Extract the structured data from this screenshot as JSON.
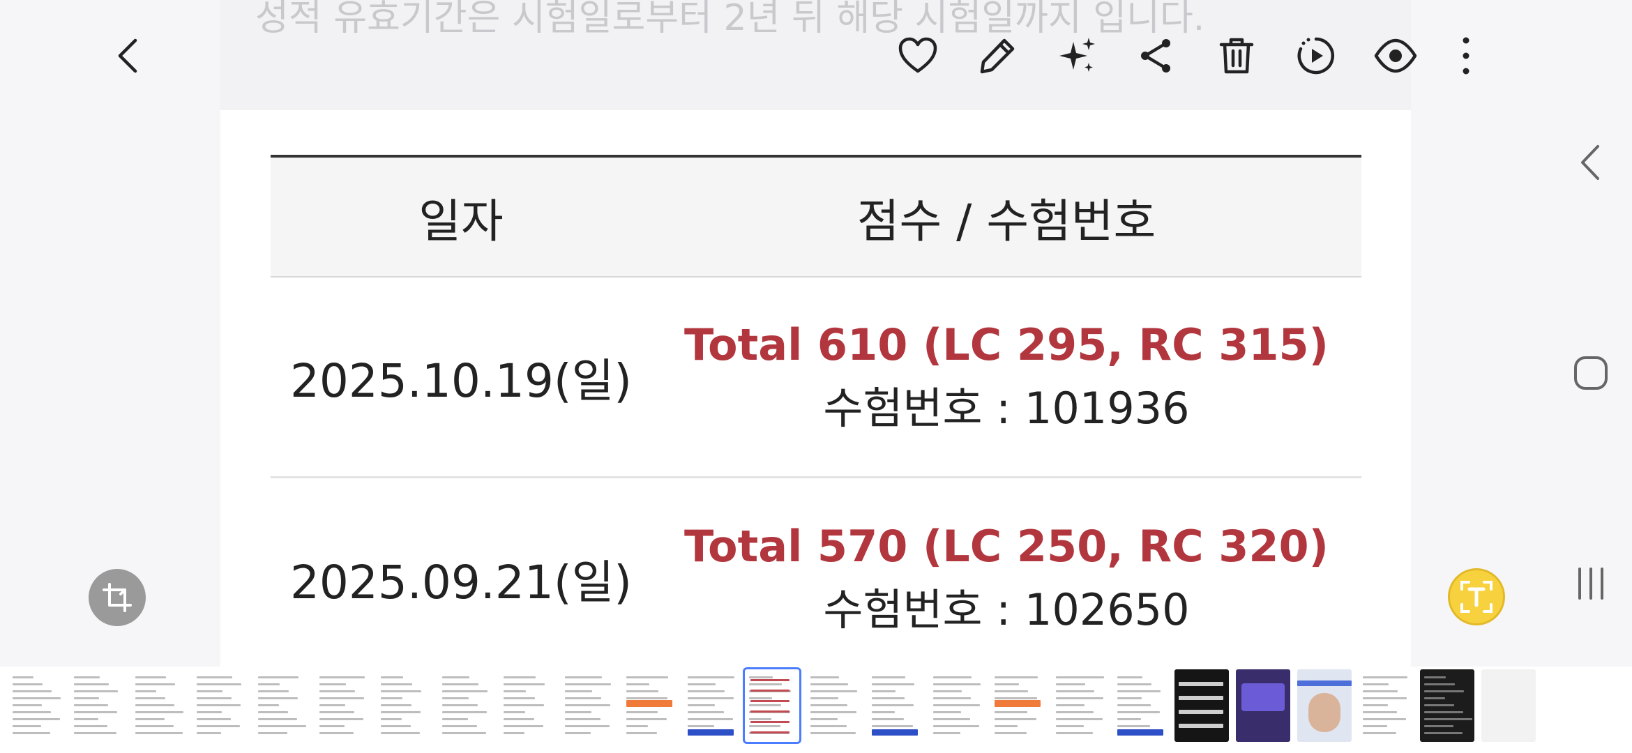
{
  "photo": {
    "faded_text": "성적 유효기간은 시험일로부터 2년 뒤 해당 시험일까지 입니다.",
    "table": {
      "headers": {
        "date": "일자",
        "score": "점수 / 수험번호"
      },
      "rows": [
        {
          "date": "2025.10.19(일)",
          "total": "Total 610 (LC 295, RC 315)",
          "regno": "수험번호 : 101936"
        },
        {
          "date": "2025.09.21(일)",
          "total": "Total 570 (LC 250, RC 320)",
          "regno": "수험번호 : 102650"
        }
      ]
    }
  },
  "toolbar": {
    "icons": [
      "back-icon",
      "heart-icon",
      "pencil-icon",
      "sparkles-icon",
      "share-icon",
      "trash-icon",
      "motion-photo-icon",
      "eye-icon",
      "more-vertical-icon"
    ]
  },
  "floating": {
    "left": "crop-icon",
    "right": "text-extract-icon"
  },
  "navigation": {
    "icons": [
      "nav-back-icon",
      "nav-home-icon",
      "nav-recents-icon"
    ]
  },
  "colors": {
    "accent_red": "#b2363d",
    "text_extract_yellow": "#f7d23e",
    "crop_gray": "#9a9a9a",
    "selected_outline": "#4a7dff"
  },
  "filmstrip": {
    "thumbnail_count": 25,
    "thumbnail_kinds": [
      "doc",
      "doc",
      "doc",
      "doc",
      "doc",
      "doc",
      "doc",
      "doc",
      "doc",
      "doc",
      "doc-orange",
      "doc-blue",
      "doc-red",
      "doc",
      "doc-blue",
      "doc",
      "doc-orange",
      "doc",
      "doc-blue",
      "dark-text",
      "photo-purple",
      "photo-portrait",
      "doc",
      "dark-doc",
      "blank"
    ]
  }
}
